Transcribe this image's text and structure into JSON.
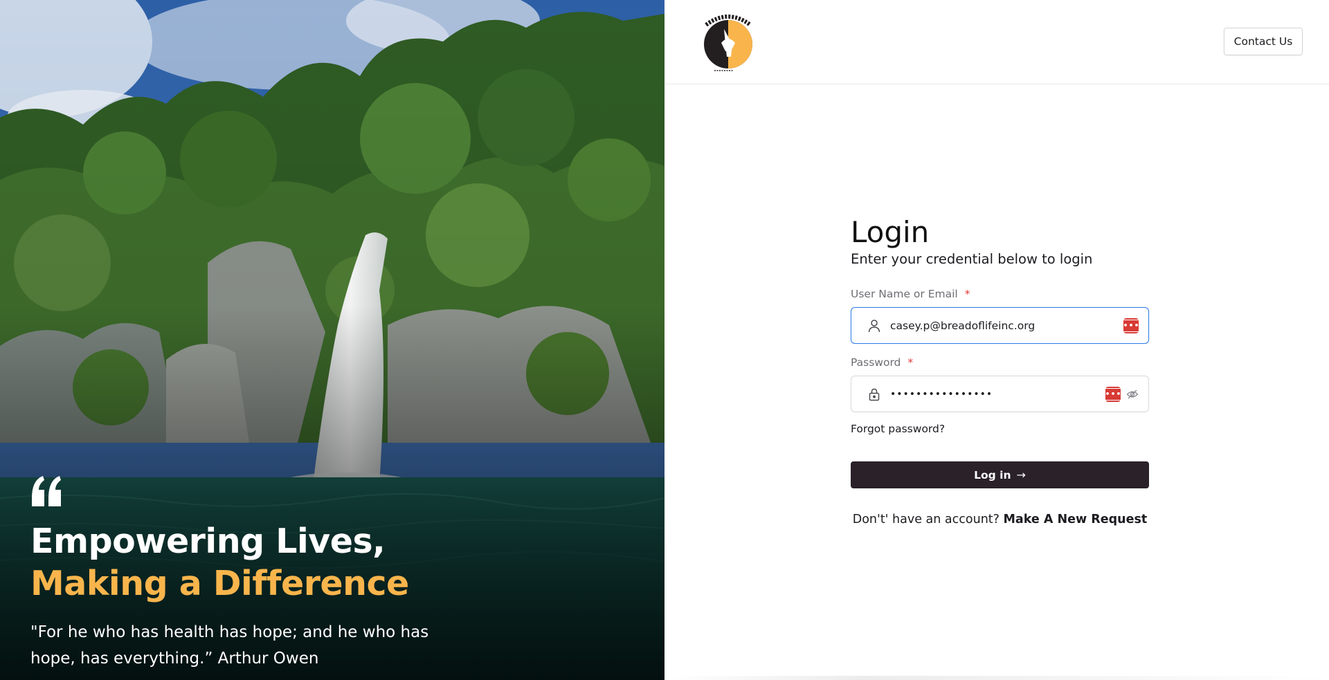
{
  "hero": {
    "title_line1": "Empowering Lives,",
    "title_line2": "Making a Difference",
    "quote": "\"For he who has health has hope; and he who has hope, has everything.” Arthur Owen",
    "accent_color": "#f9b54c"
  },
  "header": {
    "logo_text": "UPSTREAMHEALTH",
    "logo_subtext": "bread of life",
    "contact_label": "Contact Us"
  },
  "form": {
    "title": "Login",
    "subtitle": "Enter your credential below to login",
    "username": {
      "label": "User Name or Email",
      "required_mark": "*",
      "value": "casey.p@breadoflifeinc.org",
      "icon": "user-icon"
    },
    "password": {
      "label": "Password",
      "required_mark": "*",
      "value": "••••••••••••••••",
      "icon": "lock-icon"
    },
    "password_manager_icon": "password-manager-icon",
    "forgot_label": "Forgot password?",
    "submit_label": "Log in",
    "submit_arrow": "→",
    "signup_prompt": "Don't' have an account?",
    "signup_link": "Make A New Request"
  },
  "colors": {
    "button_bg": "#2a2129",
    "focus_border": "#2f7fe8",
    "required": "#e53935",
    "password_manager": "#d83a35"
  }
}
